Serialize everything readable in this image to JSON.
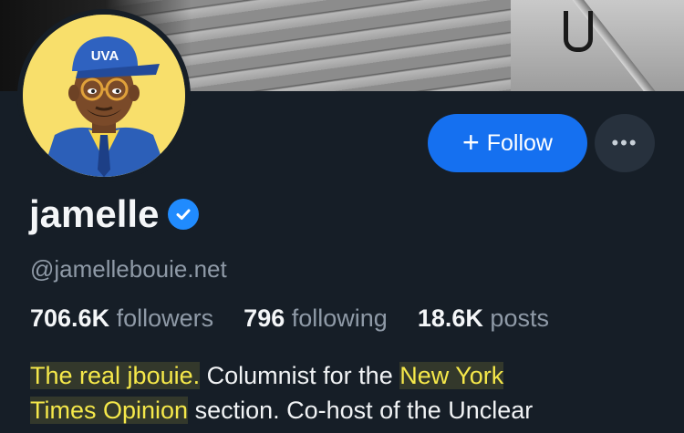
{
  "profile": {
    "display_name": "jamelle",
    "handle": "@jamellebouie.net",
    "avatar_cap_text": "UVA",
    "verified": true,
    "stats": {
      "followers_count": "706.6K",
      "followers_label": "followers",
      "following_count": "796",
      "following_label": "following",
      "posts_count": "18.6K",
      "posts_label": "posts"
    },
    "bio": {
      "line1_hl1": "The real jbouie.",
      "line1_plain": " Columnist for the ",
      "line1_hl2": "New York",
      "line2_hl": "Times Opinion",
      "line2_plain": " section. Co-host of the Unclear"
    }
  },
  "actions": {
    "follow_icon": "+",
    "follow_label": "Follow",
    "more_label": "•••"
  },
  "colors": {
    "background": "#161e27",
    "accent": "#1570f0",
    "verified_badge": "#208bfe",
    "muted_text": "#8f9aa7",
    "highlight": "#f5e84a"
  },
  "icons": [
    "plus-icon",
    "ellipsis-icon",
    "verified-check-icon"
  ]
}
